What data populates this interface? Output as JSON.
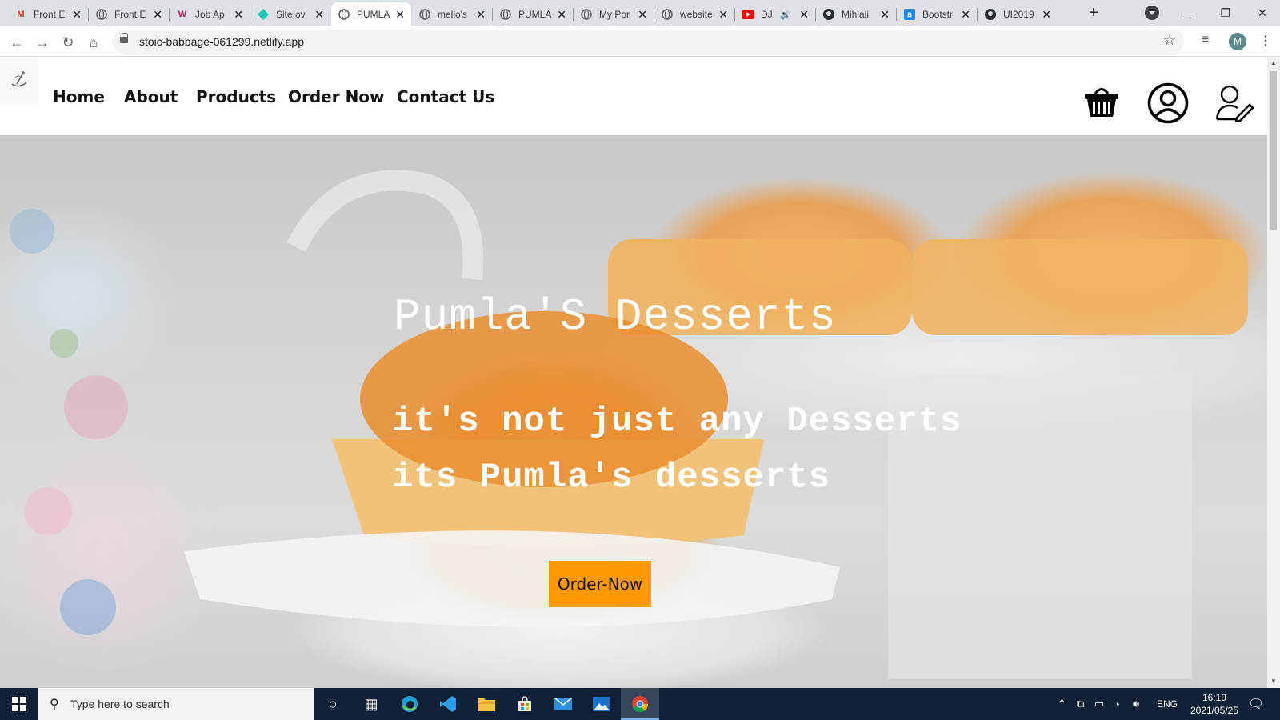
{
  "browser": {
    "tabs": [
      {
        "title": "Front E",
        "favicon": "gmail-icon"
      },
      {
        "title": "Front E",
        "favicon": "globe-icon"
      },
      {
        "title": "Job Ap",
        "favicon": "w-icon"
      },
      {
        "title": "Site ov",
        "favicon": "netlify-icon"
      },
      {
        "title": "PUMLA",
        "favicon": "globe-icon",
        "active": true
      },
      {
        "title": "mello's",
        "favicon": "globe-icon"
      },
      {
        "title": "PUMLA",
        "favicon": "globe-icon"
      },
      {
        "title": "My Por",
        "favicon": "globe-icon"
      },
      {
        "title": "website",
        "favicon": "globe-icon"
      },
      {
        "title": "DJ",
        "favicon": "youtube-icon"
      },
      {
        "title": "Mihlali",
        "favicon": "github-icon"
      },
      {
        "title": "Bootstr",
        "favicon": "bootstrap-icon"
      },
      {
        "title": "UI2019",
        "favicon": "github-icon"
      }
    ],
    "url": "stoic-babbage-061299.netlify.app",
    "profile_initial": "M"
  },
  "site": {
    "nav": {
      "links": [
        "Home",
        "About",
        "Products",
        "Order Now",
        "Contact Us"
      ]
    },
    "hero": {
      "title": "Pumla'S Desserts",
      "line1": "it's not just any Desserts",
      "line2": "its Pumla's desserts",
      "button": "Order-Now"
    },
    "colors": {
      "button_bg": "#ff9b00",
      "nav_text": "#111111"
    }
  },
  "taskbar": {
    "search_placeholder": "Type here to search",
    "language": "ENG",
    "time": "16:19",
    "date": "2021/05/25"
  }
}
